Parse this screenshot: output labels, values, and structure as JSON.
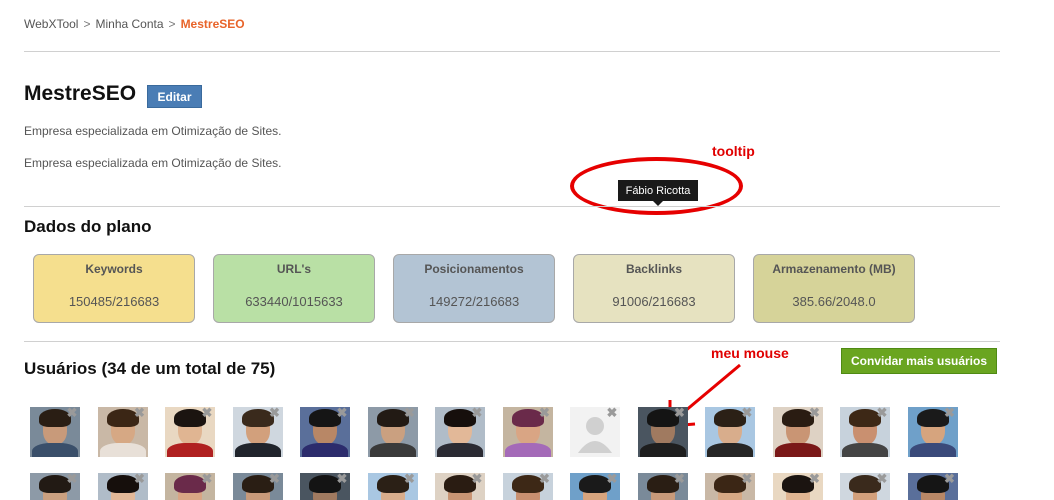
{
  "breadcrumb": {
    "items": [
      "WebXTool",
      "Minha Conta"
    ],
    "separator": ">",
    "current": "MestreSEO"
  },
  "profile": {
    "title": "MestreSEO",
    "edit_label": "Editar",
    "descriptions": [
      "Empresa especializada em Otimização de Sites.",
      "Empresa especializada em Otimização de Sites."
    ]
  },
  "tooltip": {
    "text": "Fábio Ricotta",
    "annotation": "tooltip"
  },
  "plan": {
    "title": "Dados do plano",
    "cards": [
      {
        "label": "Keywords",
        "value": "150485/216683",
        "color": "#f5df8e"
      },
      {
        "label": "URL's",
        "value": "633440/1015633",
        "color": "#b9e0a5"
      },
      {
        "label": "Posicionamentos",
        "value": "149272/216683",
        "color": "#b3c4d4"
      },
      {
        "label": "Backlinks",
        "value": "91006/216683",
        "color": "#e6e2c0"
      },
      {
        "label": "Armazenamento (MB)",
        "value": "385.66/2048.0",
        "color": "#d6d399"
      }
    ]
  },
  "users": {
    "title": "Usuários (34 de um total de 75)",
    "invite_label": "Convidar mais usuários",
    "annotation": "meu mouse",
    "remove_symbol": "✖"
  },
  "colors": {
    "breadcrumb_current": "#e8642a",
    "edit_button": "#4a7db5",
    "invite_button": "#6aa520",
    "annotation": "#e00000"
  }
}
